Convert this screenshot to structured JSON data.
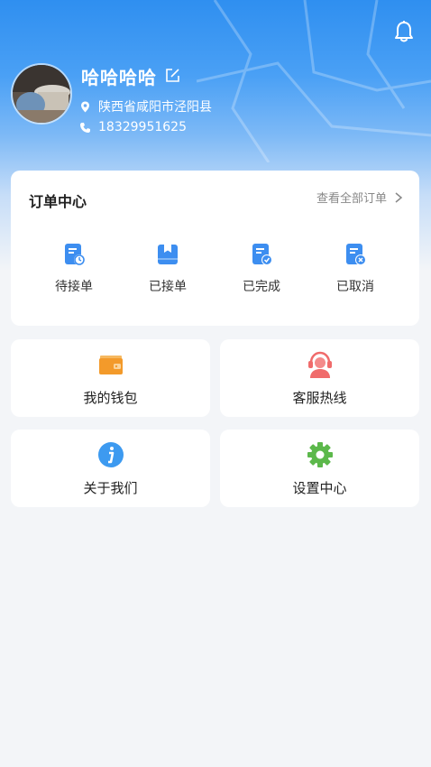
{
  "profile": {
    "name": "哈哈哈哈",
    "location": "陕西省咸阳市泾阳县",
    "phone": "18329951625"
  },
  "orders": {
    "title": "订单中心",
    "view_all": "查看全部订单",
    "items": [
      {
        "label": "待接单",
        "icon": "pending-order-icon"
      },
      {
        "label": "已接单",
        "icon": "accepted-order-icon"
      },
      {
        "label": "已完成",
        "icon": "completed-order-icon"
      },
      {
        "label": "已取消",
        "icon": "cancelled-order-icon"
      }
    ]
  },
  "tiles": [
    {
      "label": "我的钱包",
      "icon": "wallet-icon"
    },
    {
      "label": "客服热线",
      "icon": "customer-service-icon"
    },
    {
      "label": "关于我们",
      "icon": "info-icon"
    },
    {
      "label": "设置中心",
      "icon": "gear-icon"
    }
  ],
  "colors": {
    "accent": "#3d8ef0",
    "wallet": "#f39a2a",
    "service": "#f06b6b",
    "settings": "#5cb84b"
  }
}
